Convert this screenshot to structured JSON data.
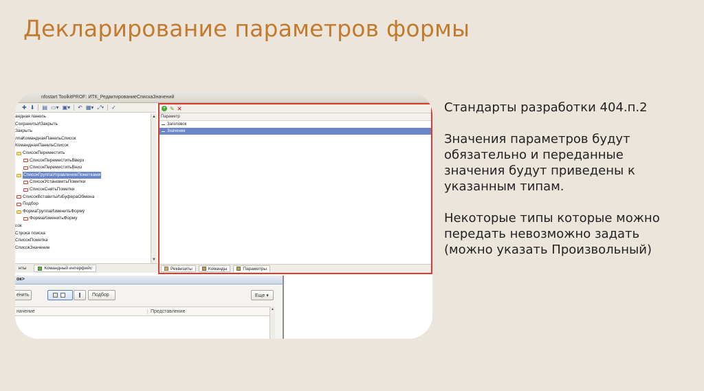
{
  "slide": {
    "title": "Декларирование параметров формы",
    "paragraphs": [
      "Стандарты разработки 404.п.2",
      "Значения параметров будут обязательно и переданные значения будут приведены к указанным типам.",
      "Некоторые типы которые можно передать невозможно задать (можно указать Произвольный)"
    ]
  },
  "screenshot": {
    "window_title": "nfostart ToolkitPROF: ИТК_РедактированиеСпискаЗначений",
    "tree": [
      {
        "label": "андная панель",
        "icon": "none",
        "indent": 0
      },
      {
        "label": "СохранитьИЗакрыть",
        "icon": "none",
        "indent": 0
      },
      {
        "label": "Закрыть",
        "icon": "none",
        "indent": 0
      },
      {
        "label": "лпаКоманднаяПанельСписок",
        "icon": "none",
        "indent": 0
      },
      {
        "label": "КоманднаяПанельСписок",
        "icon": "none",
        "indent": 0
      },
      {
        "label": "СписокПереместить",
        "icon": "folder",
        "indent": 1
      },
      {
        "label": "СписокПереместитьВверх",
        "icon": "command",
        "indent": 2
      },
      {
        "label": "СписокПереместитьВниз",
        "icon": "command",
        "indent": 2
      },
      {
        "label": "СписокГруппаУправлениеПометками",
        "icon": "folder",
        "indent": 1,
        "selected": true
      },
      {
        "label": "СписокУстановитьПометки",
        "icon": "command",
        "indent": 2
      },
      {
        "label": "СписокСнятьПометки",
        "icon": "command",
        "indent": 2
      },
      {
        "label": "СписокВставитьИзБуфераОбмена",
        "icon": "command",
        "indent": 1
      },
      {
        "label": "Подбор",
        "icon": "command",
        "indent": 1
      },
      {
        "label": "ФормаГруппаИзменитьФорму",
        "icon": "folder",
        "indent": 1
      },
      {
        "label": "ФормаИзменитьФорму",
        "icon": "command",
        "indent": 2
      },
      {
        "label": "сок",
        "icon": "none",
        "indent": 0
      },
      {
        "label": "Строка поиска",
        "icon": "none",
        "indent": 0
      },
      {
        "label": "СписокПометка",
        "icon": "none",
        "indent": 0
      },
      {
        "label": "СписокЗначение",
        "icon": "none",
        "indent": 0
      }
    ],
    "left_tabs": [
      "нты",
      "Командный интерфейс"
    ],
    "params_header": "Параметр",
    "params": [
      {
        "label": "Заголовок",
        "selected": false
      },
      {
        "label": "Значение",
        "selected": true
      }
    ],
    "right_tabs": [
      "Реквизиты",
      "Команды",
      "Параметры"
    ],
    "form_title": "ок>",
    "form_buttons": {
      "first": "енить",
      "pick": "Подбор",
      "more": "Еще ▾"
    },
    "grid_columns": [
      "начение",
      "Представление"
    ]
  },
  "colors": {
    "title": "#c27a2c",
    "background": "#ebe5dc",
    "highlight_border": "#e03a2f",
    "selection": "#6a86c6"
  }
}
